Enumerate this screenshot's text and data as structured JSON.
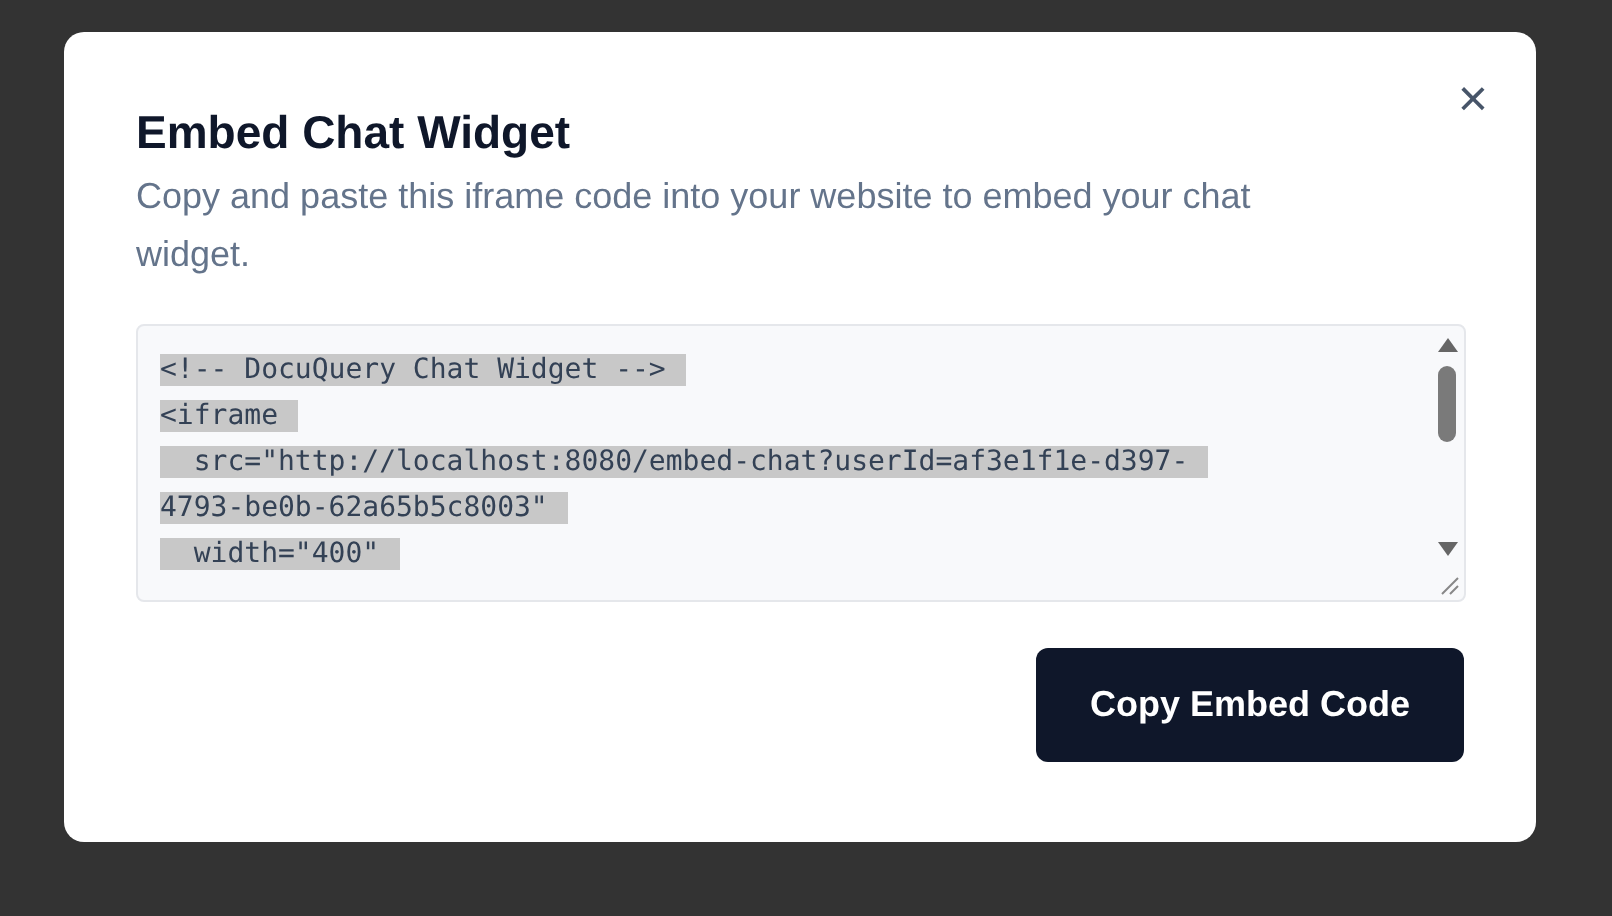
{
  "dialog": {
    "title": "Embed Chat Widget",
    "description": "Copy and paste this iframe code into your website to embed your chat widget.",
    "close_button": "×"
  },
  "code_box": {
    "selected": true,
    "lines": [
      "<!-- DocuQuery Chat Widget -->",
      "<iframe",
      "  src=\"http://localhost:8080/embed-chat?userId=af3e1f1e-d397-",
      "4793-be0b-62a65b5c8003\"",
      "  width=\"400\""
    ]
  },
  "buttons": [
    {
      "label": "Copy Embed Code"
    }
  ]
}
